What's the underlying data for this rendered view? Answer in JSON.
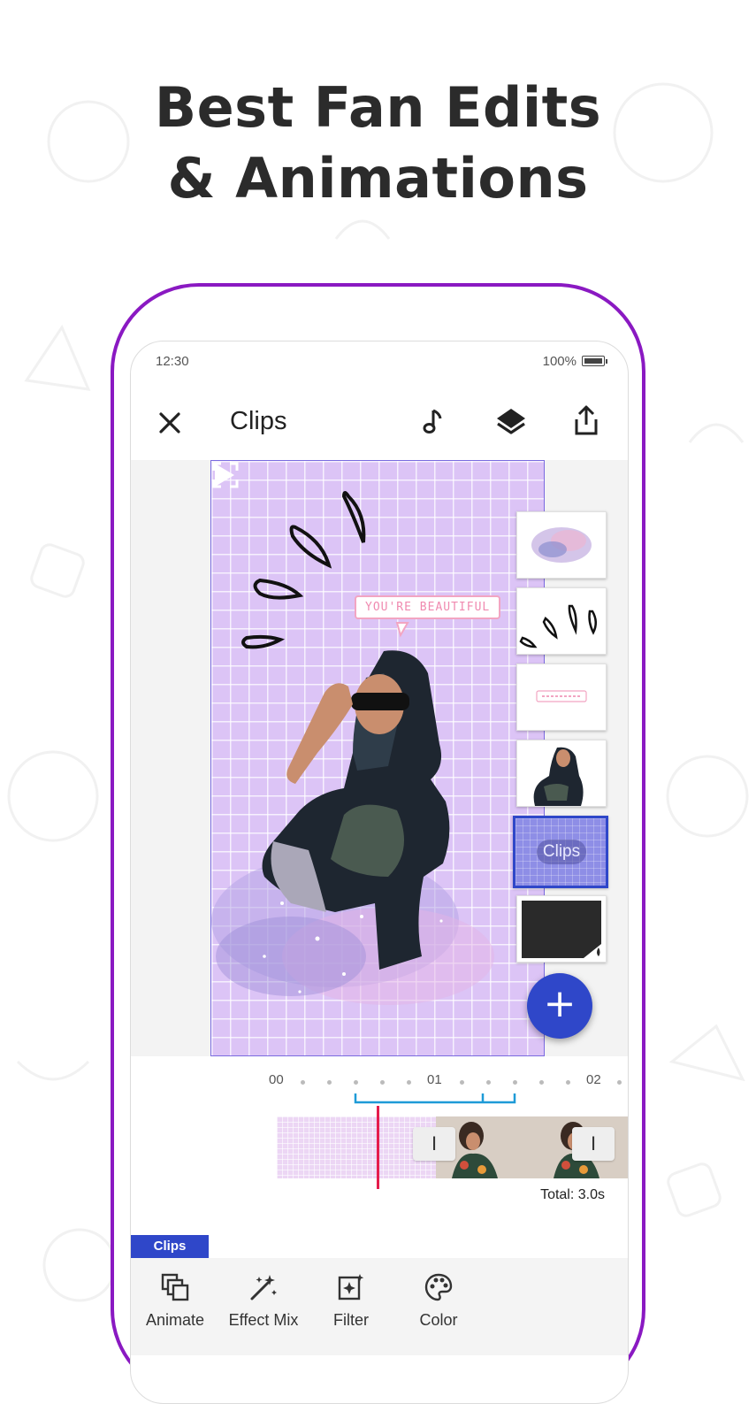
{
  "headline": {
    "line1": "Best Fan Edits",
    "line2": "& Animations"
  },
  "status_bar": {
    "time": "12:30",
    "battery": "100%"
  },
  "toolbar": {
    "title": "Clips"
  },
  "preview": {
    "bubble_text": "YOU'RE BEAUTIFUL"
  },
  "layers": {
    "selected_label": "Clips"
  },
  "timeline": {
    "ticks": [
      "00",
      "01",
      "02"
    ],
    "total": "Total: 3.0s"
  },
  "bottom": {
    "tab_tag": "Clips",
    "tools": [
      {
        "label": "Animate",
        "icon": "animate-icon"
      },
      {
        "label": "Effect Mix",
        "icon": "magic-wand-icon"
      },
      {
        "label": "Filter",
        "icon": "filter-icon"
      },
      {
        "label": "Color",
        "icon": "palette-icon"
      }
    ]
  },
  "colors": {
    "frame": "#8a19c2",
    "accent": "#2f47c9",
    "playhead": "#e51c4c",
    "grid_bg": "#dcc4f6"
  }
}
